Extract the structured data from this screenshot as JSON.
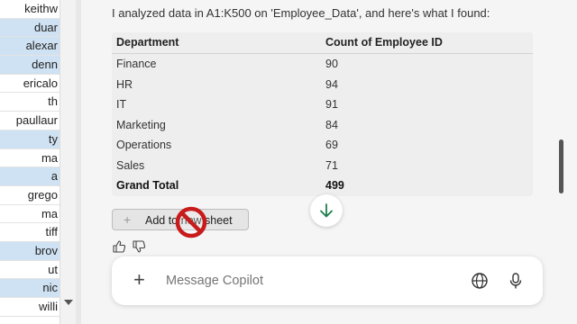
{
  "sheet": {
    "rows": [
      "keithw",
      "duar",
      "alexar",
      "denn",
      "ericalo",
      "th",
      "paullaur",
      "ty",
      "ma",
      "a",
      "grego",
      "ma",
      "tiff",
      "brov",
      "ut",
      "nic",
      "willi"
    ]
  },
  "copilot": {
    "intro": "I analyzed data in A1:K500 on 'Employee_Data', and here's what I found:",
    "table": {
      "headers": [
        "Department",
        "Count of Employee ID"
      ],
      "rows": [
        [
          "Finance",
          "90"
        ],
        [
          "HR",
          "94"
        ],
        [
          "IT",
          "91"
        ],
        [
          "Marketing",
          "84"
        ],
        [
          "Operations",
          "69"
        ],
        [
          "Sales",
          "71"
        ]
      ],
      "total": [
        "Grand Total",
        "499"
      ]
    },
    "add_button_label": "Add to new sheet",
    "composer_placeholder": "Message Copilot"
  },
  "icons": {
    "thumbs_up": "thumbs-up-icon",
    "thumbs_down": "thumbs-down-icon",
    "scroll_down": "arrow-down-icon",
    "globe": "globe-icon",
    "mic": "microphone-icon",
    "plus": "plus-icon",
    "blocked": "no-entry-icon"
  },
  "colors": {
    "accent": "#1b7f4c",
    "no_sign": "#c81b1b"
  }
}
